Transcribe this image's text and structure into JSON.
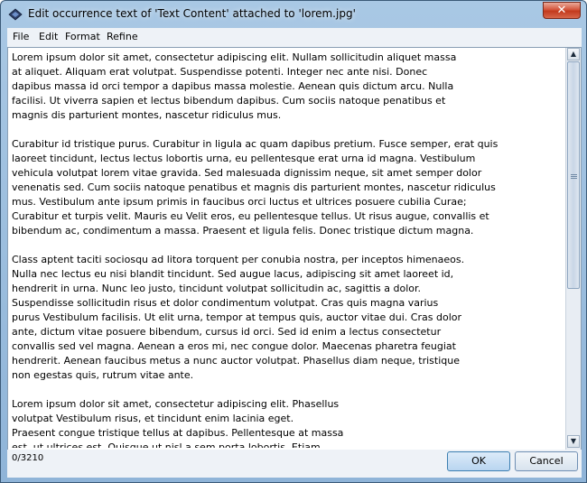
{
  "window": {
    "title": "Edit occurrence text of 'Text Content' attached to 'lorem.jpg'",
    "close_label": "✕"
  },
  "menubar": {
    "items": [
      {
        "label": "File"
      },
      {
        "label": "Edit"
      },
      {
        "label": "Format"
      },
      {
        "label": "Refine"
      }
    ]
  },
  "editor": {
    "lines": [
      "Lorem ipsum dolor sit amet, consectetur adipiscing elit. Nullam sollicitudin aliquet massa",
      "at aliquet. Aliquam erat volutpat. Suspendisse potenti. Integer nec ante nisi. Donec",
      "dapibus massa id orci tempor a dapibus massa molestie. Aenean quis dictum arcu. Nulla",
      "facilisi. Ut viverra sapien et lectus bibendum dapibus. Cum sociis natoque penatibus et",
      "magnis dis parturient montes, nascetur ridiculus mus.",
      "",
      "Curabitur id tristique purus. Curabitur in ligula ac quam dapibus pretium. Fusce semper, erat quis",
      "laoreet tincidunt, lectus lectus lobortis urna, eu pellentesque erat urna id magna. Vestibulum",
      "vehicula volutpat lorem vitae gravida. Sed malesuada dignissim neque, sit amet semper dolor",
      "venenatis sed. Cum sociis natoque penatibus et magnis dis parturient montes, nascetur ridiculus",
      "mus. Vestibulum ante ipsum primis in faucibus orci luctus et ultrices posuere cubilia Curae;",
      "Curabitur et turpis velit. Mauris eu Velit eros, eu pellentesque tellus. Ut risus augue, convallis et",
      "bibendum ac, condimentum a massa. Praesent et ligula felis. Donec tristique dictum magna.",
      "",
      "Class aptent taciti sociosqu ad litora torquent per conubia nostra, per inceptos himenaeos.",
      "Nulla nec lectus eu nisi blandit tincidunt. Sed augue lacus, adipiscing sit amet laoreet id,",
      "hendrerit in urna. Nunc leo justo, tincidunt volutpat sollicitudin ac, sagittis a dolor.",
      "Suspendisse sollicitudin risus et dolor condimentum volutpat. Cras quis magna varius",
      "purus Vestibulum facilisis. Ut elit urna, tempor at tempus quis, auctor vitae dui. Cras dolor",
      "ante, dictum vitae posuere bibendum, cursus id orci. Sed id enim a lectus consectetur",
      "convallis sed vel magna. Aenean a eros mi, nec congue dolor. Maecenas pharetra feugiat",
      "hendrerit. Aenean faucibus metus a nunc auctor volutpat. Phasellus diam neque, tristique",
      "non egestas quis, rutrum vitae ante.",
      "",
      "Lorem ipsum dolor sit amet, consectetur adipiscing elit. Phasellus",
      "volutpat Vestibulum risus, et tincidunt enim lacinia eget.",
      "Praesent congue tristique tellus at dapibus. Pellentesque at massa",
      "est, ut ultrices est. Quisque ut nisl a sem porta lobortis. Etiam"
    ],
    "scroll_position": 0.0
  },
  "statusbar": {
    "counter": "0/3210",
    "ok_label": "OK",
    "cancel_label": "Cancel"
  },
  "colors": {
    "frame": "#a9c8e4",
    "close_button": "#c23a1d",
    "ok_button": "#b9d5f0"
  }
}
